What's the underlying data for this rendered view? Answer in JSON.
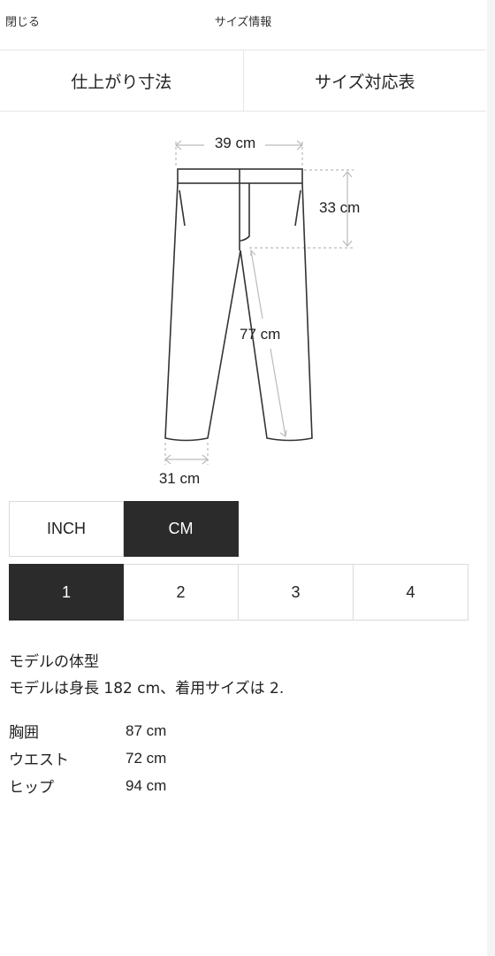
{
  "header": {
    "close_label": "閉じる",
    "title": "サイズ情報"
  },
  "tabs": [
    {
      "label": "仕上がり寸法",
      "selected": true
    },
    {
      "label": "サイズ対応表",
      "selected": false
    }
  ],
  "diagram": {
    "waist_width": "39 cm",
    "rise": "33 cm",
    "inseam": "77 cm",
    "hem_width": "31 cm"
  },
  "units": {
    "options": [
      "INCH",
      "CM"
    ],
    "selected": "CM"
  },
  "sizes": {
    "options": [
      "1",
      "2",
      "3",
      "4"
    ],
    "selected": "1"
  },
  "model": {
    "heading": "モデルの体型",
    "description": "モデルは身長 182 cm、着用サイズは 2.",
    "measurements": [
      {
        "label": "胸囲",
        "value": "87 cm"
      },
      {
        "label": "ウエスト",
        "value": "72 cm"
      },
      {
        "label": "ヒップ",
        "value": "94 cm"
      }
    ]
  },
  "colors": {
    "active_bg": "#2b2b2b",
    "border": "#dadada",
    "guide_line": "#bbbbbb"
  }
}
